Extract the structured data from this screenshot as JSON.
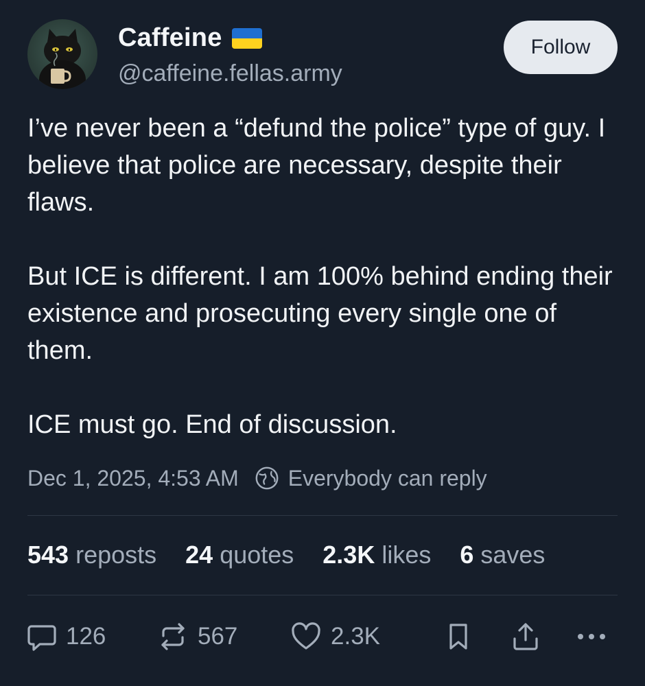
{
  "author": {
    "display_name": "Caffeine",
    "flag_icon": "ukraine-flag-icon",
    "flag_colors": [
      "#0057b7",
      "#ffd700"
    ],
    "handle": "@caffeine.fellas.army",
    "avatar_icon": "black-cat-with-coffee-avatar"
  },
  "follow_button": {
    "label": "Follow"
  },
  "post": {
    "paragraphs": [
      "I’ve never been a “defund the police” type of guy. I believe that police are necessary, despite their flaws.",
      "But ICE is different. I am 100% behind ending their existence and prosecuting every single one of them.",
      "ICE must go. End of discussion."
    ],
    "timestamp": "Dec 1, 2025, 4:53 AM",
    "reply_permission": "Everybody can reply",
    "reply_permission_icon": "globe-icon"
  },
  "stats": [
    {
      "value": "543",
      "label": "reposts"
    },
    {
      "value": "24",
      "label": "quotes"
    },
    {
      "value": "2.3K",
      "label": "likes"
    },
    {
      "value": "6",
      "label": "saves"
    }
  ],
  "actions": {
    "reply": {
      "icon": "reply-bubble-icon",
      "count": "126"
    },
    "repost": {
      "icon": "repost-icon",
      "count": "567"
    },
    "like": {
      "icon": "heart-icon",
      "count": "2.3K"
    },
    "bookmark": {
      "icon": "bookmark-icon"
    },
    "share": {
      "icon": "share-icon"
    },
    "more": {
      "icon": "more-dots-icon"
    }
  },
  "colors": {
    "background": "#161e2a",
    "text_primary": "#f1f3f5",
    "text_secondary": "#a3adba",
    "follow_button_bg": "#e6eaef",
    "divider": "#2d3744"
  }
}
